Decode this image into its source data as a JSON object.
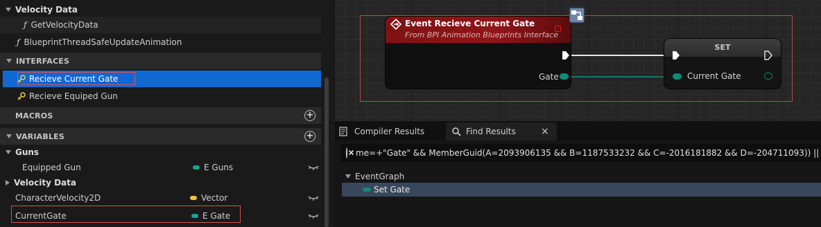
{
  "sidebar": {
    "velocity_category_1": "Velocity Data",
    "get_velocity_data": "GetVelocityData",
    "thread_safe_function": "BlueprintThreadSafeUpdateAnimation",
    "interfaces_header": "INTERFACES",
    "interfaces": [
      {
        "label": "Recieve Current Gate",
        "selected": true
      },
      {
        "label": "Recieve Equiped Gun",
        "selected": false
      }
    ],
    "macros_header": "MACROS",
    "variables_header": "VARIABLES",
    "guns_category": "Guns",
    "velocity_category_2": "Velocity Data",
    "variables": [
      {
        "name": "Equipped Gun",
        "type": "E Guns",
        "type_color": "#1aa38e"
      },
      {
        "name": "CharacterVelocity2D",
        "type": "Vector",
        "type_color": "#f5c431"
      },
      {
        "name": "CurrentGate",
        "type": "E Gate",
        "type_color": "#1aa38e"
      }
    ]
  },
  "graph": {
    "event_node": {
      "title": "Event Recieve Current Gate",
      "subtitle": "From BPI Animation Blueprints Interface",
      "output_pin": "Gate"
    },
    "set_node": {
      "title": "SET",
      "input_pin": "Current Gate"
    },
    "colors": {
      "selection": "#c8454c",
      "event_header": "#8f1518",
      "enum_pin": "#0f8a7a"
    }
  },
  "results_panel": {
    "tabs": [
      {
        "label": "Compiler Results",
        "active": false
      },
      {
        "label": "Find Results",
        "active": true
      }
    ],
    "tab_close": "×",
    "search_query": "me=+\"Gate\" && MemberGuid(A=2093906135 && B=1187533232 && C=-2016181882 && D=-204711093)) || Name=\"(G",
    "results": {
      "group": "EventGraph",
      "item": "Set Gate"
    }
  }
}
